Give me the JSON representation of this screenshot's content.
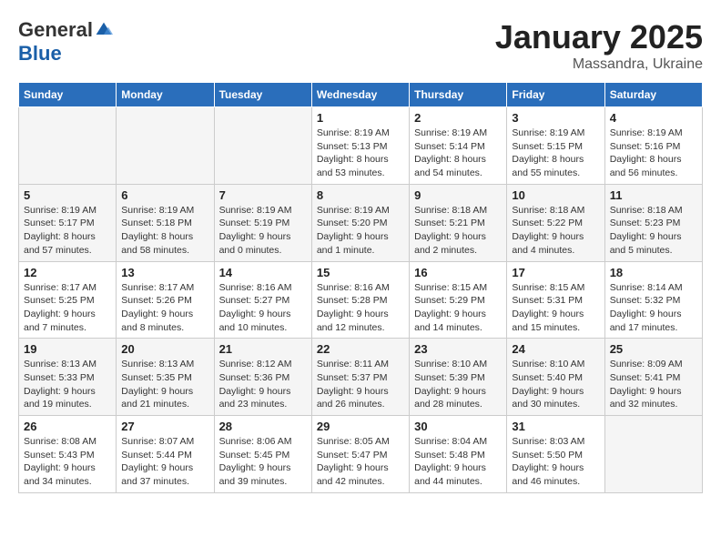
{
  "logo": {
    "general": "General",
    "blue": "Blue"
  },
  "title": {
    "month": "January 2025",
    "location": "Massandra, Ukraine"
  },
  "weekdays": [
    "Sunday",
    "Monday",
    "Tuesday",
    "Wednesday",
    "Thursday",
    "Friday",
    "Saturday"
  ],
  "weeks": [
    [
      {
        "day": "",
        "info": ""
      },
      {
        "day": "",
        "info": ""
      },
      {
        "day": "",
        "info": ""
      },
      {
        "day": "1",
        "info": "Sunrise: 8:19 AM\nSunset: 5:13 PM\nDaylight: 8 hours\nand 53 minutes."
      },
      {
        "day": "2",
        "info": "Sunrise: 8:19 AM\nSunset: 5:14 PM\nDaylight: 8 hours\nand 54 minutes."
      },
      {
        "day": "3",
        "info": "Sunrise: 8:19 AM\nSunset: 5:15 PM\nDaylight: 8 hours\nand 55 minutes."
      },
      {
        "day": "4",
        "info": "Sunrise: 8:19 AM\nSunset: 5:16 PM\nDaylight: 8 hours\nand 56 minutes."
      }
    ],
    [
      {
        "day": "5",
        "info": "Sunrise: 8:19 AM\nSunset: 5:17 PM\nDaylight: 8 hours\nand 57 minutes."
      },
      {
        "day": "6",
        "info": "Sunrise: 8:19 AM\nSunset: 5:18 PM\nDaylight: 8 hours\nand 58 minutes."
      },
      {
        "day": "7",
        "info": "Sunrise: 8:19 AM\nSunset: 5:19 PM\nDaylight: 9 hours\nand 0 minutes."
      },
      {
        "day": "8",
        "info": "Sunrise: 8:19 AM\nSunset: 5:20 PM\nDaylight: 9 hours\nand 1 minute."
      },
      {
        "day": "9",
        "info": "Sunrise: 8:18 AM\nSunset: 5:21 PM\nDaylight: 9 hours\nand 2 minutes."
      },
      {
        "day": "10",
        "info": "Sunrise: 8:18 AM\nSunset: 5:22 PM\nDaylight: 9 hours\nand 4 minutes."
      },
      {
        "day": "11",
        "info": "Sunrise: 8:18 AM\nSunset: 5:23 PM\nDaylight: 9 hours\nand 5 minutes."
      }
    ],
    [
      {
        "day": "12",
        "info": "Sunrise: 8:17 AM\nSunset: 5:25 PM\nDaylight: 9 hours\nand 7 minutes."
      },
      {
        "day": "13",
        "info": "Sunrise: 8:17 AM\nSunset: 5:26 PM\nDaylight: 9 hours\nand 8 minutes."
      },
      {
        "day": "14",
        "info": "Sunrise: 8:16 AM\nSunset: 5:27 PM\nDaylight: 9 hours\nand 10 minutes."
      },
      {
        "day": "15",
        "info": "Sunrise: 8:16 AM\nSunset: 5:28 PM\nDaylight: 9 hours\nand 12 minutes."
      },
      {
        "day": "16",
        "info": "Sunrise: 8:15 AM\nSunset: 5:29 PM\nDaylight: 9 hours\nand 14 minutes."
      },
      {
        "day": "17",
        "info": "Sunrise: 8:15 AM\nSunset: 5:31 PM\nDaylight: 9 hours\nand 15 minutes."
      },
      {
        "day": "18",
        "info": "Sunrise: 8:14 AM\nSunset: 5:32 PM\nDaylight: 9 hours\nand 17 minutes."
      }
    ],
    [
      {
        "day": "19",
        "info": "Sunrise: 8:13 AM\nSunset: 5:33 PM\nDaylight: 9 hours\nand 19 minutes."
      },
      {
        "day": "20",
        "info": "Sunrise: 8:13 AM\nSunset: 5:35 PM\nDaylight: 9 hours\nand 21 minutes."
      },
      {
        "day": "21",
        "info": "Sunrise: 8:12 AM\nSunset: 5:36 PM\nDaylight: 9 hours\nand 23 minutes."
      },
      {
        "day": "22",
        "info": "Sunrise: 8:11 AM\nSunset: 5:37 PM\nDaylight: 9 hours\nand 26 minutes."
      },
      {
        "day": "23",
        "info": "Sunrise: 8:10 AM\nSunset: 5:39 PM\nDaylight: 9 hours\nand 28 minutes."
      },
      {
        "day": "24",
        "info": "Sunrise: 8:10 AM\nSunset: 5:40 PM\nDaylight: 9 hours\nand 30 minutes."
      },
      {
        "day": "25",
        "info": "Sunrise: 8:09 AM\nSunset: 5:41 PM\nDaylight: 9 hours\nand 32 minutes."
      }
    ],
    [
      {
        "day": "26",
        "info": "Sunrise: 8:08 AM\nSunset: 5:43 PM\nDaylight: 9 hours\nand 34 minutes."
      },
      {
        "day": "27",
        "info": "Sunrise: 8:07 AM\nSunset: 5:44 PM\nDaylight: 9 hours\nand 37 minutes."
      },
      {
        "day": "28",
        "info": "Sunrise: 8:06 AM\nSunset: 5:45 PM\nDaylight: 9 hours\nand 39 minutes."
      },
      {
        "day": "29",
        "info": "Sunrise: 8:05 AM\nSunset: 5:47 PM\nDaylight: 9 hours\nand 42 minutes."
      },
      {
        "day": "30",
        "info": "Sunrise: 8:04 AM\nSunset: 5:48 PM\nDaylight: 9 hours\nand 44 minutes."
      },
      {
        "day": "31",
        "info": "Sunrise: 8:03 AM\nSunset: 5:50 PM\nDaylight: 9 hours\nand 46 minutes."
      },
      {
        "day": "",
        "info": ""
      }
    ]
  ]
}
